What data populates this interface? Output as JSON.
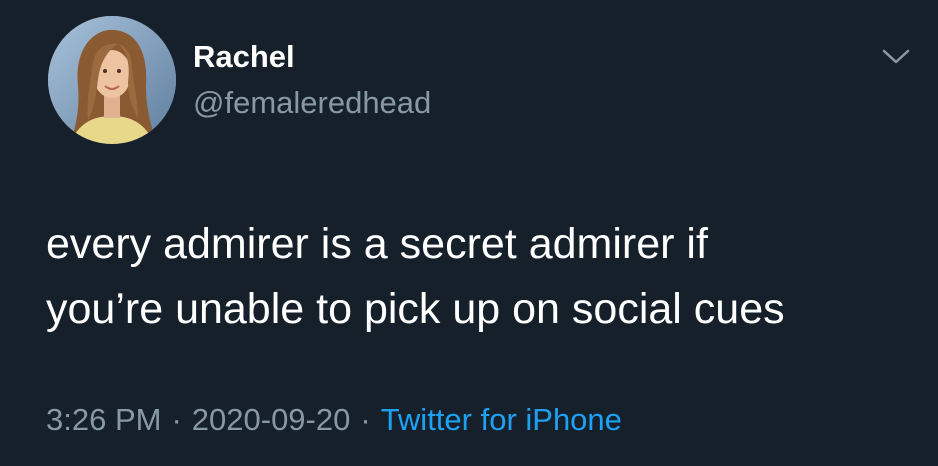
{
  "tweet": {
    "author": {
      "name": "Rachel",
      "handle": "@femaleredhead",
      "avatar_icon": "profile-photo"
    },
    "menu_icon": "chevron-down-icon",
    "text_lines": [
      "every admirer is a secret admirer if",
      "you’re unable to pick up on social cues"
    ],
    "time": "3:26 PM",
    "separator": "·",
    "date": "2020-09-20",
    "source": "Twitter for iPhone"
  },
  "colors": {
    "background": "#15202b",
    "primary_text": "#ffffff",
    "secondary_text": "#8899a6",
    "link": "#1da1f2"
  }
}
